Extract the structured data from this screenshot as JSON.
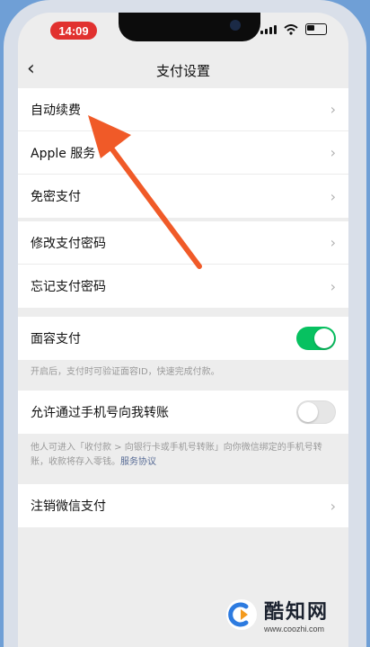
{
  "status_bar": {
    "time": "14:09"
  },
  "nav": {
    "back_glyph": "‹",
    "title": "支付设置"
  },
  "groups": [
    {
      "rows": [
        {
          "label": "自动续费",
          "chevron": "›"
        },
        {
          "label": "Apple 服务",
          "chevron": "›"
        },
        {
          "label": "免密支付",
          "chevron": "›"
        }
      ]
    },
    {
      "rows": [
        {
          "label": "修改支付密码",
          "chevron": "›"
        },
        {
          "label": "忘记支付密码",
          "chevron": "›"
        }
      ]
    },
    {
      "rows": [
        {
          "label": "面容支付",
          "toggle": true
        }
      ],
      "note": "开启后，支付时可验证面容ID，快速完成付款。"
    },
    {
      "rows": [
        {
          "label": "允许通过手机号向我转账",
          "toggle": false
        }
      ],
      "note": "他人可进入「收付款 > 向银行卡或手机号转账」向你微信绑定的手机号转账，收款将存入零钱。",
      "note_link": "服务协议"
    },
    {
      "rows": [
        {
          "label": "注销微信支付",
          "chevron": "›"
        }
      ]
    }
  ],
  "watermark": {
    "title": "酷知网",
    "url": "www.coozhi.com"
  },
  "colors": {
    "toggle_on": "#07c160",
    "arrow": "#f05a28",
    "time_pill": "#e1312f"
  }
}
